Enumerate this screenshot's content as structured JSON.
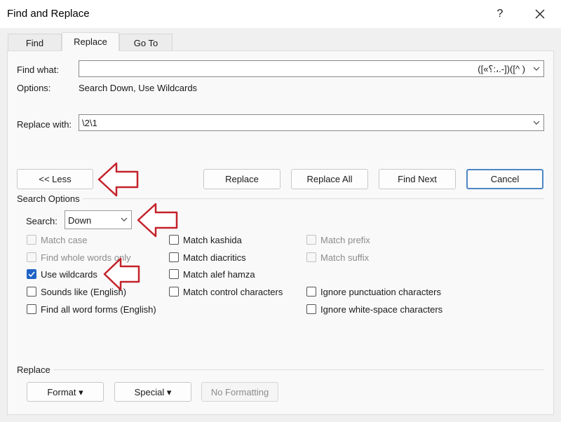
{
  "window": {
    "title": "Find and Replace",
    "help": "?"
  },
  "tabs": [
    {
      "label": "Find"
    },
    {
      "label": "Replace"
    },
    {
      "label": "Go To"
    }
  ],
  "find": {
    "label": "Find what:",
    "value": "([«؟:،.-])(‎[^ ‎)"
  },
  "options": {
    "label": "Options:",
    "value": "Search Down, Use Wildcards"
  },
  "replace": {
    "label": "Replace with:",
    "value": "\\2\\1"
  },
  "buttons": {
    "less": "<< Less",
    "replace": "Replace",
    "replace_all": "Replace All",
    "find_next": "Find Next",
    "cancel": "Cancel"
  },
  "search_options": {
    "heading": "Search Options",
    "search_label": "Search:",
    "search_value": "Down"
  },
  "checkboxes": {
    "match_case": "Match case",
    "whole_words": "Find whole words only",
    "use_wildcards": "Use wildcards",
    "sounds_like": "Sounds like (English)",
    "word_forms": "Find all word forms (English)",
    "match_kashida": "Match kashida",
    "match_diacritics": "Match diacritics",
    "match_alef_hamza": "Match alef hamza",
    "match_control": "Match control characters",
    "match_prefix": "Match prefix",
    "match_suffix": "Match suffix",
    "ignore_punct": "Ignore punctuation characters",
    "ignore_whitespace": "Ignore white-space characters"
  },
  "replace_section": {
    "heading": "Replace",
    "format": "Format ▾",
    "special": "Special ▾",
    "no_formatting": "No Formatting"
  },
  "colors": {
    "accent": "#1f63c6",
    "annotation_arrow": "#c4222a"
  }
}
